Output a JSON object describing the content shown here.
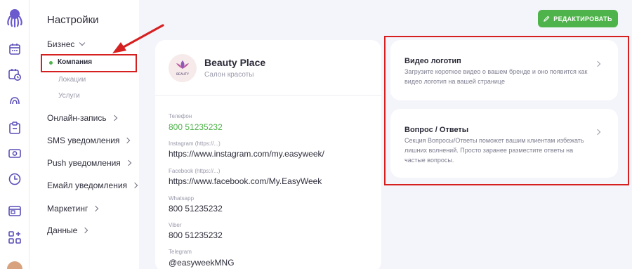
{
  "rail": {
    "icons": [
      "octopus-logo-icon",
      "calendar-icon",
      "calendar-clock-icon",
      "clients-icon",
      "clipboard-icon",
      "cash-icon",
      "clock-icon",
      "browser-window-icon",
      "apps-add-icon",
      "avatar"
    ]
  },
  "settings": {
    "title": "Настройки",
    "business": {
      "label": "Бизнес"
    },
    "sub_items": {
      "company": "Компания",
      "locations": "Локации",
      "services": "Услуги"
    },
    "menu": {
      "online_booking": "Онлайн-запись",
      "sms": "SMS уведомления",
      "push": "Push уведомления",
      "email": "Емайл уведомления",
      "marketing": "Маркетинг",
      "data": "Данные"
    }
  },
  "toolbar": {
    "edit_label": "РЕДАКТИРОВАТЬ"
  },
  "company": {
    "name": "Beauty Place",
    "type": "Салон красоты",
    "logo_text": "BEAUTY",
    "fields": {
      "phone": {
        "label": "Телефон",
        "value": "800 51235232"
      },
      "instagram": {
        "label": "Instagram (https://...)",
        "value": "https://www.instagram.com/my.easyweek/"
      },
      "facebook": {
        "label": "Facebook (https://...)",
        "value": "https://www.facebook.com/My.EasyWeek"
      },
      "whatsapp": {
        "label": "Whatsapp",
        "value": "800 51235232"
      },
      "viber": {
        "label": "Viber",
        "value": "800 51235232"
      },
      "telegram": {
        "label": "Telegram",
        "value": "@easyweekMNG"
      }
    }
  },
  "cards": {
    "video": {
      "title": "Видео логотип",
      "desc": "Загрузите короткое видео о вашем бренде и оно появится как видео логотип на вашей странице"
    },
    "faq": {
      "title": "Вопрос / Ответы",
      "desc": "Секция Вопросы/Ответы поможет вашим клиентам избежать лишних волнений. Просто заранее разместите ответы на частые вопросы."
    }
  },
  "colors": {
    "accent_green": "#4fb34b",
    "highlight_red": "#d62020",
    "background": "#f4f4fb"
  }
}
